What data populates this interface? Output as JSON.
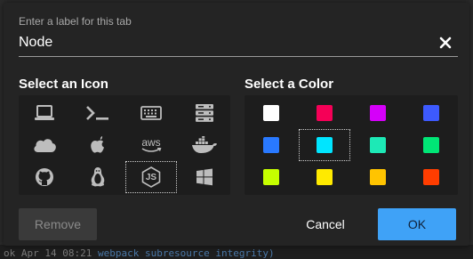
{
  "background_terminal": {
    "prefix": "ok Apr 14 08:21 ",
    "highlight": "webpack subresource integrity)"
  },
  "dialog": {
    "label_caption": "Enter a label for this tab",
    "label_value": "Node",
    "icon_section_title": "Select an Icon",
    "color_section_title": "Select a Color",
    "icons": [
      {
        "name": "laptop-icon"
      },
      {
        "name": "terminal-icon"
      },
      {
        "name": "keyboard-icon"
      },
      {
        "name": "server-icon"
      },
      {
        "name": "cloud-icon"
      },
      {
        "name": "apple-icon"
      },
      {
        "name": "aws-icon",
        "text": "aws"
      },
      {
        "name": "docker-icon"
      },
      {
        "name": "github-icon"
      },
      {
        "name": "linux-icon"
      },
      {
        "name": "nodejs-icon",
        "text": "JS",
        "selected": true
      },
      {
        "name": "windows-icon"
      }
    ],
    "colors": [
      {
        "name": "white",
        "hex": "#ffffff"
      },
      {
        "name": "red",
        "hex": "#f50057"
      },
      {
        "name": "magenta",
        "hex": "#d500f9"
      },
      {
        "name": "indigo",
        "hex": "#3d5afe"
      },
      {
        "name": "blue",
        "hex": "#2979ff"
      },
      {
        "name": "cyan",
        "hex": "#00e5ff",
        "selected": true
      },
      {
        "name": "teal",
        "hex": "#1de9b6"
      },
      {
        "name": "green",
        "hex": "#00e676"
      },
      {
        "name": "lime",
        "hex": "#c6ff00"
      },
      {
        "name": "yellow",
        "hex": "#ffea00"
      },
      {
        "name": "amber",
        "hex": "#ffc400"
      },
      {
        "name": "orange",
        "hex": "#ff3d00"
      }
    ],
    "remove_label": "Remove",
    "cancel_label": "Cancel",
    "ok_label": "OK"
  }
}
